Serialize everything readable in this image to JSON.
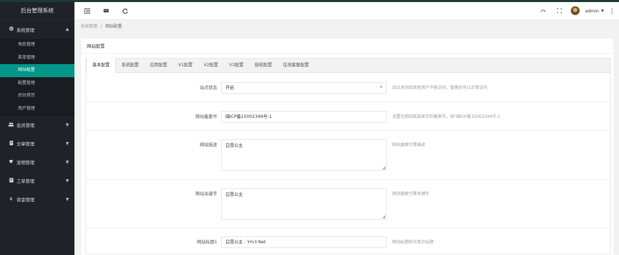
{
  "app": {
    "title": "后台管理系统"
  },
  "sidebar": {
    "groups": [
      {
        "label": "系统管理",
        "icon": "gear-icon",
        "expanded": true,
        "items": [
          "角色管理",
          "菜单管理",
          "网站配置",
          "配置管理",
          "后台首页",
          "用户管理"
        ],
        "active_item": "网站配置"
      },
      {
        "label": "会员管理",
        "icon": "users-icon",
        "expanded": false
      },
      {
        "label": "文章管理",
        "icon": "document-icon",
        "expanded": false
      },
      {
        "label": "宠物管理",
        "icon": "heart-icon",
        "expanded": false
      },
      {
        "label": "工单管理",
        "icon": "ticket-icon",
        "expanded": false
      },
      {
        "label": "资金管理",
        "icon": "yen-icon",
        "expanded": false
      }
    ]
  },
  "header": {
    "left_icons": [
      "menu-toggle-icon",
      "home-icon",
      "refresh-icon"
    ],
    "right_icons": [
      "theme-icon",
      "fullscreen-icon"
    ],
    "user": "admin"
  },
  "breadcrumb": {
    "parent": "系统管理",
    "separator": "/",
    "current": "网站配置"
  },
  "card": {
    "title": "网站配置",
    "tabs": [
      "基本配置",
      "系统配置",
      "应用配置",
      "V1配置",
      "V2配置",
      "V3配置",
      "授权配置",
      "在线客服配置"
    ],
    "active_tab": "基本配置"
  },
  "form": {
    "status": {
      "label": "站点状态",
      "value": "开启",
      "hint": "站点关闭后其他用户不能访问，管理员可以正常访问"
    },
    "icp": {
      "label": "网站备案号",
      "value": "闽ICP备15002349号-1",
      "hint": "设置在网站底部显示的备案号，如\"闽ICP备15002349号-1"
    },
    "description": {
      "label": "网站描述",
      "value": "白雪公主",
      "hint": "网站搜索引擎描述"
    },
    "keywords": {
      "label": "网站关键字",
      "value": "白雪公主",
      "hint": "网站搜索引擎关键字"
    },
    "title1": {
      "label": "网站标题1",
      "value": "白雪公主 - Ym3.Net",
      "hint": "网站标题前台显示标题"
    }
  },
  "colors": {
    "sidebar_bg": "#20222a",
    "accent": "#009688"
  }
}
